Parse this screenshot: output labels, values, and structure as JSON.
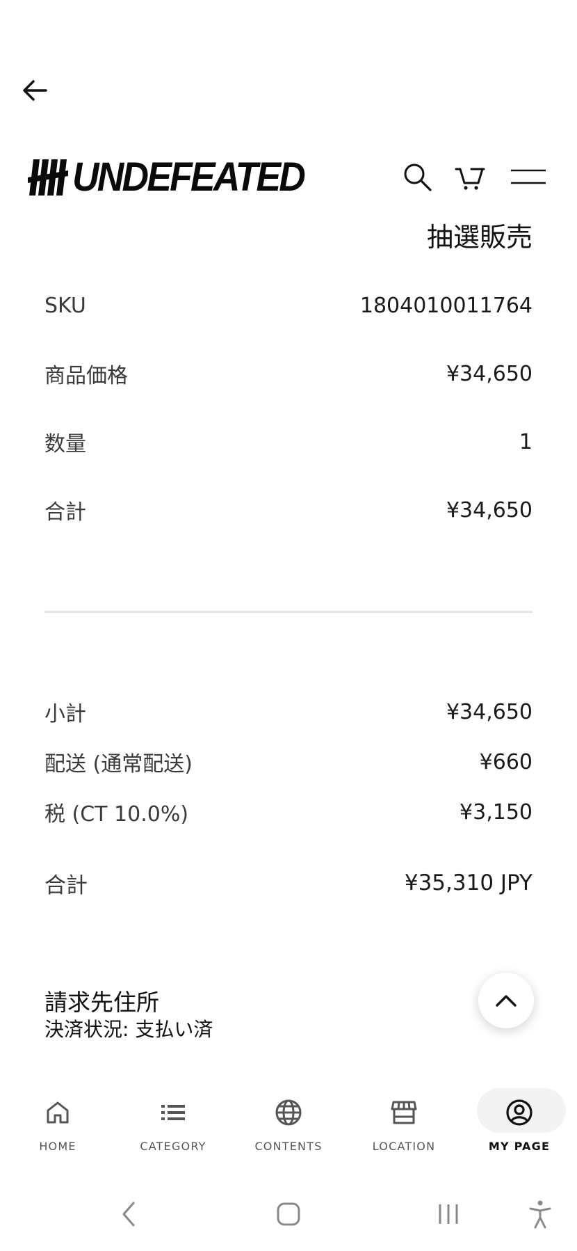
{
  "header": {
    "brand": "UNDEFEATED"
  },
  "order": {
    "sale_type": "抽選販売",
    "items": [
      {
        "label": "SKU",
        "value": "1804010011764"
      },
      {
        "label": "商品価格",
        "value": "¥34,650"
      },
      {
        "label": "数量",
        "value": "1"
      },
      {
        "label": "合計",
        "value": "¥34,650"
      }
    ]
  },
  "summary": {
    "rows": [
      {
        "label": "小計",
        "value": "¥34,650"
      },
      {
        "label": "配送 (通常配送)",
        "value": "¥660"
      },
      {
        "label": "税 (CT 10.0%)",
        "value": "¥3,150"
      }
    ],
    "total_label": "合計",
    "total_value": "¥35,310 JPY"
  },
  "billing": {
    "title": "請求先住所",
    "status": "決済状況: 支払い済"
  },
  "tabbar": {
    "items": [
      {
        "label": "HOME",
        "icon": "home-icon"
      },
      {
        "label": "CATEGORY",
        "icon": "list-icon"
      },
      {
        "label": "CONTENTS",
        "icon": "globe-icon"
      },
      {
        "label": "LOCATION",
        "icon": "store-icon"
      },
      {
        "label": "MY PAGE",
        "icon": "user-circle-icon",
        "active": true
      }
    ]
  }
}
